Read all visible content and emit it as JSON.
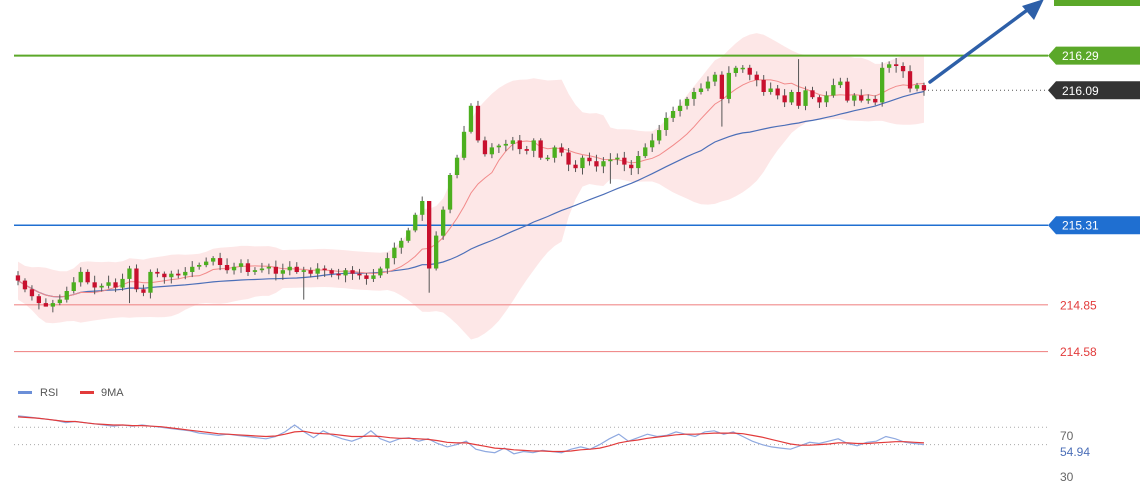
{
  "chart_data": [
    {
      "type": "candlestick",
      "title": "",
      "y_range": [
        214.3,
        216.6
      ],
      "levels": [
        {
          "name": "resistance",
          "value": 216.29,
          "label": "216.29",
          "color": "#5ba829"
        },
        {
          "name": "current-price",
          "value": 216.09,
          "label": "216.09",
          "color": "#333333"
        },
        {
          "name": "pivot",
          "value": 215.31,
          "label": "215.31",
          "color": "#1f6fd1"
        },
        {
          "name": "support-1",
          "value": 214.85,
          "label": "214.85",
          "color": "#f08c8c"
        },
        {
          "name": "support-2",
          "value": 214.58,
          "label": "214.58",
          "color": "#f08c8c"
        }
      ],
      "candles_close": [
        214.99,
        214.94,
        214.9,
        214.86,
        214.84,
        214.86,
        214.88,
        214.93,
        214.98,
        215.04,
        214.98,
        214.95,
        214.96,
        214.98,
        214.95,
        215.0,
        215.06,
        214.94,
        214.92,
        215.04,
        215.03,
        215.01,
        215.03,
        215.02,
        215.04,
        215.07,
        215.08,
        215.1,
        215.12,
        215.08,
        215.05,
        215.07,
        215.09,
        215.04,
        215.05,
        215.06,
        215.07,
        215.03,
        215.05,
        215.07,
        215.04,
        215.05,
        215.03,
        215.06,
        215.05,
        215.03,
        215.02,
        215.05,
        215.03,
        215.02,
        215.0,
        215.02,
        215.06,
        215.12,
        215.18,
        215.22,
        215.28,
        215.37,
        215.45,
        215.06,
        215.25,
        215.4,
        215.6,
        215.7,
        215.85,
        216.0,
        215.8,
        215.72,
        215.76,
        215.77,
        215.78,
        215.8,
        215.75,
        215.74,
        215.8,
        215.7,
        215.7,
        215.76,
        215.73,
        215.66,
        215.64,
        215.7,
        215.68,
        215.65,
        215.68,
        215.69,
        215.7,
        215.66,
        215.64,
        215.71,
        215.76,
        215.8,
        215.86,
        215.93,
        215.97,
        216.0,
        216.04,
        216.08,
        216.1,
        216.14,
        216.18,
        216.04,
        216.19,
        216.22,
        216.22,
        216.18,
        216.15,
        216.08,
        216.1,
        216.06,
        216.02,
        216.08,
        216.0,
        216.09,
        216.05,
        216.02,
        216.06,
        216.12,
        216.14,
        216.03,
        216.06,
        216.03,
        216.04,
        216.02,
        216.22,
        216.24,
        216.23,
        216.2,
        216.1,
        216.12,
        216.09
      ],
      "candles_low_extremes": {
        "min": 214.84,
        "max_high": 216.27
      },
      "moving_average_fast": true,
      "moving_average_slow": true,
      "bollinger_bands": true,
      "trend_arrow": "up"
    },
    {
      "type": "line",
      "title": "",
      "legend": [
        {
          "name": "RSI",
          "color": "#6b8fd8"
        },
        {
          "name": "9MA",
          "color": "#e23b3b"
        }
      ],
      "y_ticks": [
        "70",
        "54.94",
        "30"
      ],
      "last_value": "54.94",
      "series": [
        {
          "name": "RSI",
          "values": [
            80,
            79,
            78,
            77,
            76,
            74,
            75,
            74,
            73,
            72,
            71,
            72,
            71,
            72,
            71,
            70,
            69,
            68,
            67,
            65,
            64,
            63,
            64,
            63,
            62,
            61,
            60,
            62,
            66,
            72,
            66,
            61,
            67,
            63,
            60,
            58,
            61,
            67,
            60,
            57,
            60,
            61,
            58,
            60,
            56,
            53,
            55,
            58,
            51,
            49,
            48,
            52,
            47,
            49,
            48,
            50,
            49,
            48,
            51,
            53,
            51,
            55,
            60,
            64,
            58,
            61,
            64,
            62,
            63,
            66,
            64,
            62,
            66,
            67,
            64,
            66,
            62,
            58,
            55,
            53,
            52,
            51,
            54,
            57,
            56,
            58,
            60,
            56,
            54,
            57,
            58,
            62,
            60,
            57,
            56,
            55
          ]
        },
        {
          "name": "9MA",
          "values": [
            79,
            78.5,
            78,
            77,
            76,
            75,
            75,
            74,
            73,
            72.5,
            72,
            72,
            71.5,
            71.5,
            71,
            70.5,
            69.5,
            68.5,
            67.5,
            66.5,
            65.5,
            64.5,
            64,
            63.5,
            63,
            62.5,
            62,
            62.5,
            64,
            66,
            66.5,
            65,
            64.5,
            64,
            63,
            62,
            62,
            62.5,
            62,
            61,
            60.5,
            60.5,
            60,
            59.5,
            58.5,
            57,
            56.5,
            56.5,
            55,
            53.5,
            52,
            51.5,
            50.5,
            50,
            49.5,
            49.5,
            49,
            49,
            49.5,
            50.5,
            51,
            52,
            54,
            56.5,
            58,
            59,
            60.5,
            61.5,
            62.5,
            63.5,
            64,
            64,
            64.5,
            65,
            65,
            65,
            64.5,
            63,
            61.5,
            59.5,
            57.5,
            55.5,
            54.5,
            54.5,
            55,
            55.5,
            56.5,
            56.5,
            56,
            56,
            56.5,
            57,
            57.5,
            57.5,
            57,
            56.5
          ]
        }
      ]
    }
  ],
  "colors": {
    "bull": "#4caf1f",
    "bear": "#c8102e",
    "band_fill": "#fde3e3",
    "ma_fast": "#f28a8a",
    "ma_slow": "#4c6fb8",
    "arrow": "#2d5fa8"
  }
}
